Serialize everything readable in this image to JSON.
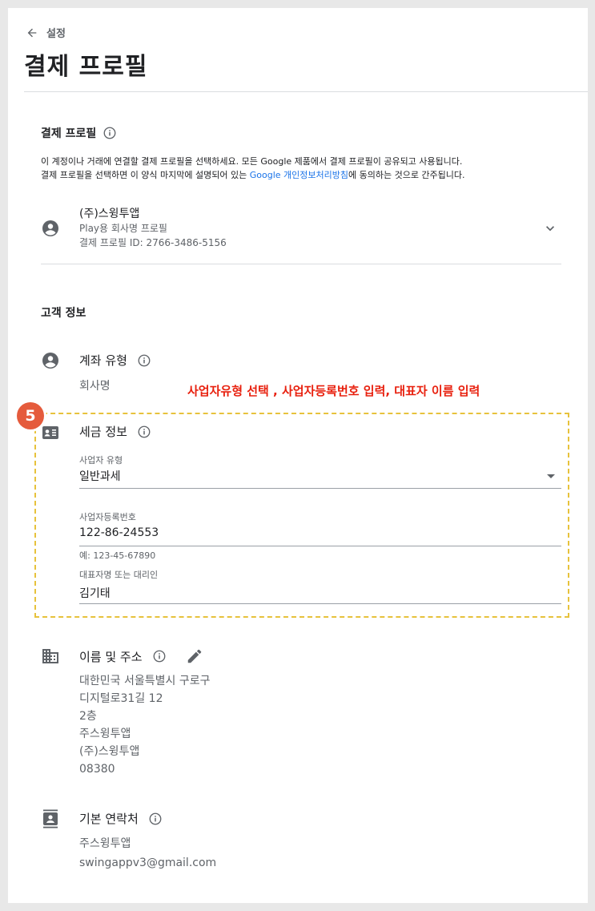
{
  "header": {
    "back_label": "설정",
    "title": "결제 프로필"
  },
  "payment_profile": {
    "section_title": "결제 프로필",
    "description_line1": "이 계정이나 거래에 연결할 결제 프로필을 선택하세요. 모든 Google 제품에서 결제 프로필이 공유되고 사용됩니다.",
    "description_line2_prefix": "결제 프로필을 선택하면 이 양식 마지막에 설명되어 있는 ",
    "description_link": "Google 개인정보처리방침",
    "description_line2_suffix": "에 동의하는 것으로 간주됩니다.",
    "profile_name": "(주)스윙투앱",
    "profile_type": "Play용 회사명 프로필",
    "profile_id": "결제 프로필 ID: 2766-3486-5156"
  },
  "customer_info": {
    "section_title": "고객 정보",
    "account_type": {
      "label": "계좌 유형",
      "value": "회사명"
    },
    "annotation": "사업자유형 선택 , 사업자등록번호 입력, 대표자 이름 입력",
    "step_number": "5",
    "tax_info": {
      "label": "세금 정보",
      "business_type_label": "사업자 유형",
      "business_type_value": "일반과세",
      "reg_number_label": "사업자등록번호",
      "reg_number_value": "122-86-24553",
      "reg_number_hint": "예: 123-45-67890",
      "representative_label": "대표자명 또는 대리인",
      "representative_value": "김기태"
    },
    "name_address": {
      "label": "이름 및 주소",
      "lines": [
        "대한민국 서울특별시 구로구",
        "디지털로31길 12",
        "2층",
        "주스윙투앱",
        "(주)스윙투앱",
        "08380"
      ]
    },
    "primary_contact": {
      "label": "기본 연락처",
      "name": "주스윙투앱",
      "email": "swingappv3@gmail.com"
    }
  },
  "colors": {
    "accent_link": "#1a73e8",
    "annotation_red": "#e8200e",
    "badge": "#e55b3c",
    "dash_border": "#e7c23c"
  }
}
